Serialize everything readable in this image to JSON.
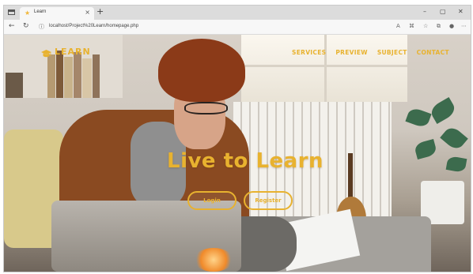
{
  "browser": {
    "tab_title": "Learn",
    "tab_close": "×",
    "new_tab": "+",
    "url": "localhost/Project%20Learn/homepage.php",
    "controls": {
      "minimize": "–",
      "maximize": "▢",
      "close": "✕"
    }
  },
  "site": {
    "logo_text": "LEARN",
    "nav": [
      "SERVICES",
      "PREVIEW",
      "SUBJECT",
      "CONTACT"
    ],
    "hero_title": "Live to Learn",
    "buttons": {
      "login": "Login",
      "register": "Register"
    }
  },
  "colors": {
    "accent": "#e8b22f",
    "tab_strip": "#dcdcdc",
    "toolbar": "#f7f7f7"
  }
}
